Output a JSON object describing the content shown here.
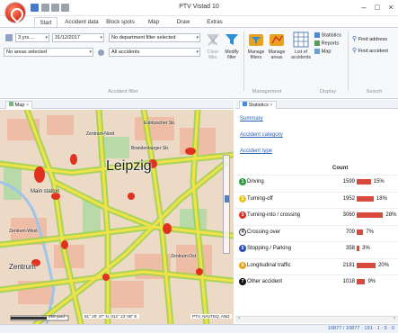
{
  "window": {
    "title": "PTV Vistad 10",
    "minimize_glyph": "–",
    "maximize_glyph": "□",
    "close_glyph": "×"
  },
  "tabs": [
    "Start",
    "Accident data",
    "Block spots",
    "Map",
    "Draw",
    "Extras"
  ],
  "ribbon": {
    "time_period": "3 yrs....",
    "date": "31/12/2017",
    "department_filter": "No department filter selected",
    "areas": "No areas selected",
    "accidents": "All accidents",
    "clear_filter": "Clear filter",
    "modify_filter": "Modify filter",
    "manage_filters": "Manage filters",
    "manage_areas": "Manage areas",
    "list_of_accidents": "List of accidents",
    "statistics": "Statistics",
    "reports": "Reports",
    "map": "Map",
    "find_address": "Find address",
    "find_accident": "Find accident",
    "group_accident_filter": "Accident filter",
    "group_management": "Management",
    "group_display": "Display",
    "group_search": "Search"
  },
  "map_pane": {
    "tab_label": "Map",
    "city_label": "Leipzig",
    "main_station": "Main station",
    "zentrum": "Zentrum",
    "scale": "250 yard",
    "coordinates": "51° 20' 47\" N, 012° 22' 08\" E",
    "copyright": "PTV, NAVTEQ, AND",
    "districts": [
      "Zentrum-Ost",
      "Zentrum-Nord",
      "Zentrum-West",
      "Eutritzscher Str.",
      "Brandenburger Str."
    ]
  },
  "stats_pane": {
    "tab_label": "Statistics",
    "links": [
      "Summary",
      "Accident category",
      "Accident type"
    ],
    "count_header": "Count",
    "rows": [
      {
        "badge": "1",
        "label": "Driving",
        "count": "1599",
        "pct_label": "15%",
        "pct": 15,
        "color": "#2e9a3c"
      },
      {
        "badge": "2",
        "label": "Turning-off",
        "count": "1952",
        "pct_label": "18%",
        "pct": 18,
        "color": "#e8c61f"
      },
      {
        "badge": "3",
        "label": "Turning-into / crossing",
        "count": "3060",
        "pct_label": "28%",
        "pct": 28,
        "color": "#d9341c"
      },
      {
        "badge": "4",
        "label": "Crossing over",
        "count": "709",
        "pct_label": "7%",
        "pct": 7,
        "color": "#ffffff"
      },
      {
        "badge": "5",
        "label": "Stopping / Parking",
        "count": "358",
        "pct_label": "3%",
        "pct": 3,
        "color": "#2a4fb8"
      },
      {
        "badge": "6",
        "label": "Longitudinal traffic",
        "count": "2181",
        "pct_label": "20%",
        "pct": 20,
        "color": "#e8a21f"
      },
      {
        "badge": "7",
        "label": "Other accident",
        "count": "1018",
        "pct_label": "9%",
        "pct": 9,
        "color": "#111111"
      }
    ]
  },
  "status": {
    "text": "10877 / 10877 · 191 · 1 · 5 · 0"
  }
}
